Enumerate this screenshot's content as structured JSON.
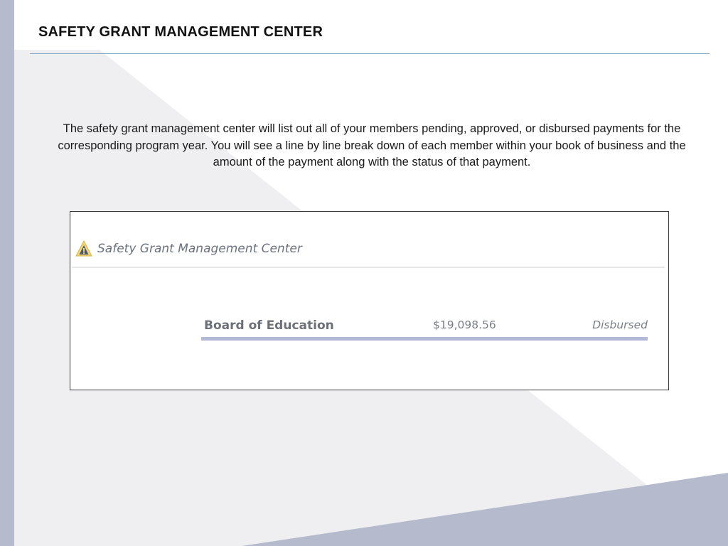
{
  "slide": {
    "title": "SAFETY GRANT MANAGEMENT CENTER",
    "description": "The safety grant management center will list out all of your members pending, approved, or disbursed payments for the corresponding program year. You will see a line by line break down of each member within your book of business and the amount of the payment along with the status of that payment."
  },
  "screenshot": {
    "header_icon": "warning-triangle-icon",
    "header_title": "Safety Grant Management Center",
    "rows": [
      {
        "member": "Board of Education",
        "amount": "$19,098.56",
        "status": "Disbursed"
      }
    ]
  },
  "colors": {
    "accent_bar": "#b2b9d6",
    "title_rule": "#7fa7cc",
    "background_shape": "#efeff1"
  }
}
